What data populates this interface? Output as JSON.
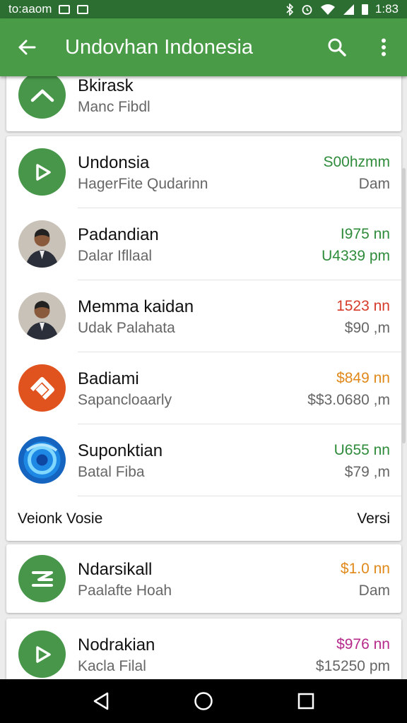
{
  "status_bar": {
    "left_text": "to:aaom",
    "time": "1:83",
    "icons": [
      "image-icon",
      "notification-icon",
      "bluetooth-icon",
      "alarm-icon",
      "wifi-icon",
      "signal-icon",
      "battery-icon"
    ]
  },
  "app_bar": {
    "title": "Undovhan Indonesia",
    "back_icon": "arrow-left-icon",
    "search_icon": "search-icon",
    "menu_icon": "more-vert-icon",
    "color": "#4a9b47"
  },
  "top_item": {
    "name": "Bkirask",
    "sub": "Manc Fibdl",
    "icon": "chevron-up-icon"
  },
  "list": {
    "items": [
      {
        "name": "Undonsia",
        "sub": "HagerFite Qudarinn",
        "price": "S00hzmm",
        "unit": "Dam",
        "price_color": "#2e8b3a",
        "unit_color": "#666666",
        "avatar": "play-icon"
      },
      {
        "name": "Padandian",
        "sub": "Dalar Ifllaal",
        "price": "I975 nn",
        "unit": "U4339 pm",
        "price_color": "#2e8b3a",
        "unit_color": "#2e8b3a",
        "avatar": "person-photo"
      },
      {
        "name": "Memma kaidan",
        "sub": "Udak Palahata",
        "price": "1523 nn",
        "unit": "$90 ,m",
        "price_color": "#d63b2a",
        "unit_color": "#666666",
        "avatar": "person-photo"
      },
      {
        "name": "Badiami",
        "sub": "Sapancloaarly",
        "price": "$849 nn",
        "unit": "$$3.0680 ,m",
        "price_color": "#e0891a",
        "unit_color": "#666666",
        "avatar": "orange-app-icon"
      },
      {
        "name": "Suponktian",
        "sub": "Batal Fiba",
        "price": "U655 nn",
        "unit": "$79 ,m",
        "price_color": "#2e8b3a",
        "unit_color": "#666666",
        "avatar": "blue-app-icon"
      }
    ],
    "footer_left": "Veionk Vosie",
    "footer_right": "Versi"
  },
  "card_a": {
    "name": "Ndarsikall",
    "sub": "Paalafte Hoah",
    "price": "$1.0 nn",
    "unit": "Dam",
    "price_color": "#e0891a",
    "unit_color": "#666666",
    "avatar": "ticket-icon"
  },
  "card_b": {
    "name": "Nodrakian",
    "sub": "Kacla Filal",
    "price": "$976 nn",
    "unit": "$15250 pm",
    "price_color": "#b52a8a",
    "unit_color": "#666666",
    "avatar": "play-icon"
  },
  "nav_bar": {
    "icons": [
      "back-triangle-icon",
      "home-circle-icon",
      "recents-square-icon"
    ]
  }
}
